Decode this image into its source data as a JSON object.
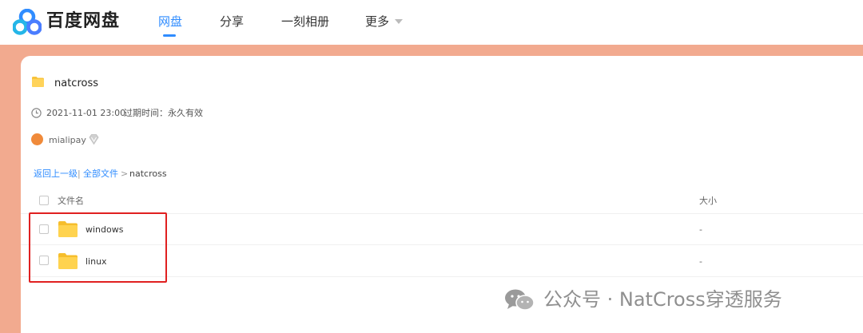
{
  "brand": {
    "name": "百度网盘",
    "colors": {
      "blue": "#2f8cff",
      "accent_bar": "#f2aa8f"
    }
  },
  "nav": {
    "items": [
      {
        "label": "网盘",
        "active": true
      },
      {
        "label": "分享",
        "active": false
      },
      {
        "label": "一刻相册",
        "active": false
      },
      {
        "label": "更多",
        "active": false
      }
    ]
  },
  "share": {
    "title": "natcross",
    "date": "2021-11-01 23:00",
    "expire": "过期时间：永久有效",
    "user": "mialipay",
    "icons": [
      "folder-icon",
      "clock-icon",
      "avatar-icon",
      "vip-diamond-icon"
    ]
  },
  "breadcrumb": {
    "back": "返回上一级",
    "separator": "|",
    "all_files": "全部文件",
    "arrow": ">",
    "current": "natcross"
  },
  "table": {
    "columns": {
      "name": "文件名",
      "size": "大小"
    },
    "rows": [
      {
        "name": "windows",
        "size": "-"
      },
      {
        "name": "linux",
        "size": "-"
      }
    ],
    "highlight_color": "#e02020"
  },
  "watermark": {
    "text": "公众号 · NatCross穿透服务"
  }
}
